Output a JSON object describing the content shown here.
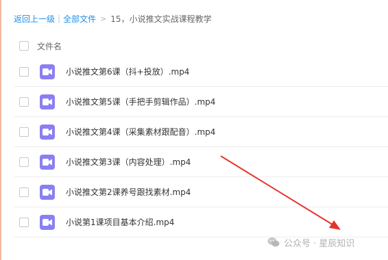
{
  "breadcrumb": {
    "back": "返回上一级",
    "separator": "|",
    "all_files": "全部文件",
    "arrow": ">",
    "current": "15，小说推文实战课程教学"
  },
  "list": {
    "header": "文件名",
    "files": [
      {
        "name": "小说推文第6课（抖+投放）.mp4",
        "icon": "video-icon"
      },
      {
        "name": "小说推文第5课（手把手剪辑作品）.mp4",
        "icon": "video-icon"
      },
      {
        "name": "小说推文第4课（采集素材跟配音）.mp4",
        "icon": "video-icon"
      },
      {
        "name": "小说推文第3课（内容处理）.mp4",
        "icon": "video-icon"
      },
      {
        "name": "小说推文第2课养号跟找素材.mp4",
        "icon": "video-icon"
      },
      {
        "name": "小说第1课项目基本介绍.mp4",
        "icon": "video-icon"
      }
    ]
  },
  "watermark": {
    "text": "公众号 · 星辰知识",
    "icon": "wechat-icon"
  },
  "colors": {
    "link": "#1f8ee6",
    "file_icon": "#8a7ff2",
    "annotation_arrow": "#e8312a"
  }
}
